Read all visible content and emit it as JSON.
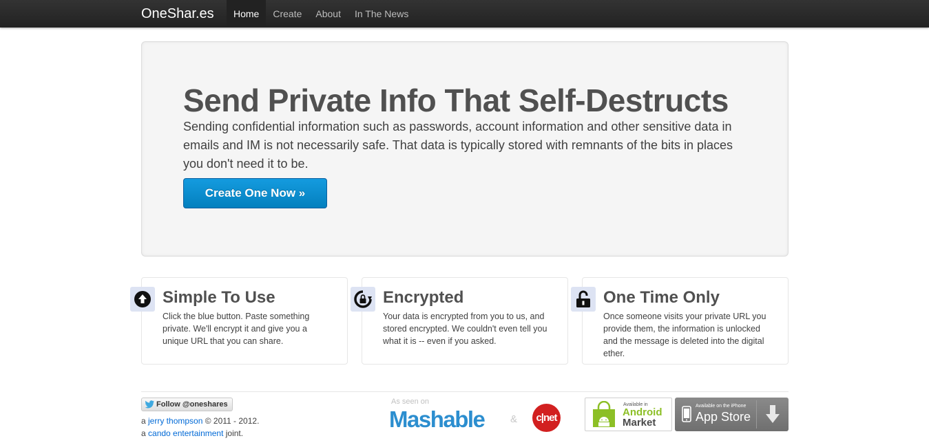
{
  "navbar": {
    "brand": "OneShar.es",
    "items": [
      {
        "label": "Home",
        "active": true
      },
      {
        "label": "Create",
        "active": false
      },
      {
        "label": "About",
        "active": false
      },
      {
        "label": "In The News",
        "active": false
      }
    ]
  },
  "hero": {
    "title": "Send Private Info That Self-Destructs",
    "text": "Sending confidential information such as passwords, account information and other sensitive data in emails and IM is not necessarily safe. That data is typically stored with remnants of the bits in places you don't need it to be.",
    "button_label": "Create One Now »"
  },
  "features": [
    {
      "icon": "upload-arrow-icon",
      "title": "Simple To Use",
      "text": "Click the blue button. Paste something private. We'll encrypt it and give you a unique URL that you can share."
    },
    {
      "icon": "refresh-lock-icon",
      "title": "Encrypted",
      "text": "Your data is encrypted from you to us, and stored encrypted. We couldn't even tell you what it is -- even if you asked."
    },
    {
      "icon": "unlocked-padlock-icon",
      "title": "One Time Only",
      "text": "Once someone visits your private URL you provide them, the information is unlocked and the message is deleted into the digital ether."
    }
  ],
  "footer": {
    "follow_label": "Follow @oneshares",
    "credit1_prefix": "a ",
    "credit1_link": "jerry thompson",
    "credit1_suffix": " © 2011 - 2012.",
    "credit2_prefix": "a ",
    "credit2_link": "cando entertainment",
    "credit2_suffix": " joint.",
    "as_seen_on": "As seen on",
    "mashable": "Mashable",
    "amp": "&",
    "cnet": "c|net",
    "android_small": "Available in",
    "android_line1": "Android",
    "android_line2": "Market",
    "appstore_small": "Available on the iPhone",
    "appstore_big": "App Store"
  },
  "colors": {
    "navbar": "#222222",
    "primary_button": "#0480be",
    "link": "#0069d6",
    "android_green": "#8cbf26",
    "cnet_red": "#d22020",
    "mashable_blue": "#2c8ecf"
  }
}
